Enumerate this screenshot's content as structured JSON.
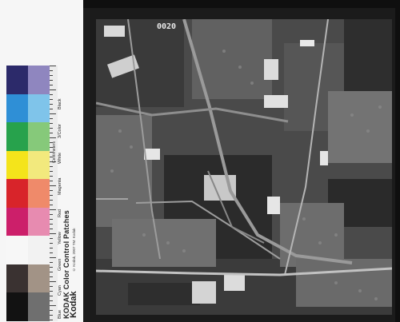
{
  "frame_number": "0020",
  "color_card": {
    "title": "KODAK Color Control Patches",
    "labels": [
      "Blue",
      "Cyan",
      "Green",
      "Yellow",
      "Red",
      "Magenta",
      "White",
      "3/Color",
      "Black"
    ],
    "brand": "Kodak",
    "ruler_label": "Centimeters",
    "small_print": "© Kodak, 2007  TM: Kodak",
    "patch_colors": [
      [
        "#2c2a6a",
        "#8f86bf"
      ],
      [
        "#2f8fd6",
        "#7fc4ea"
      ],
      [
        "#27a24c",
        "#86c97a"
      ],
      [
        "#f4e41b",
        "#f2e97d"
      ],
      [
        "#d8242a",
        "#ef8a6a"
      ],
      [
        "#cc1f6a",
        "#e78bb0"
      ],
      [
        "#f7f7f7",
        "#f2f2f2"
      ],
      [
        "#3a3231",
        "#a29386"
      ],
      [
        "#121212",
        "#6f6f6f"
      ]
    ]
  },
  "photo": {
    "description_icon": "aerial-photo-icon"
  }
}
